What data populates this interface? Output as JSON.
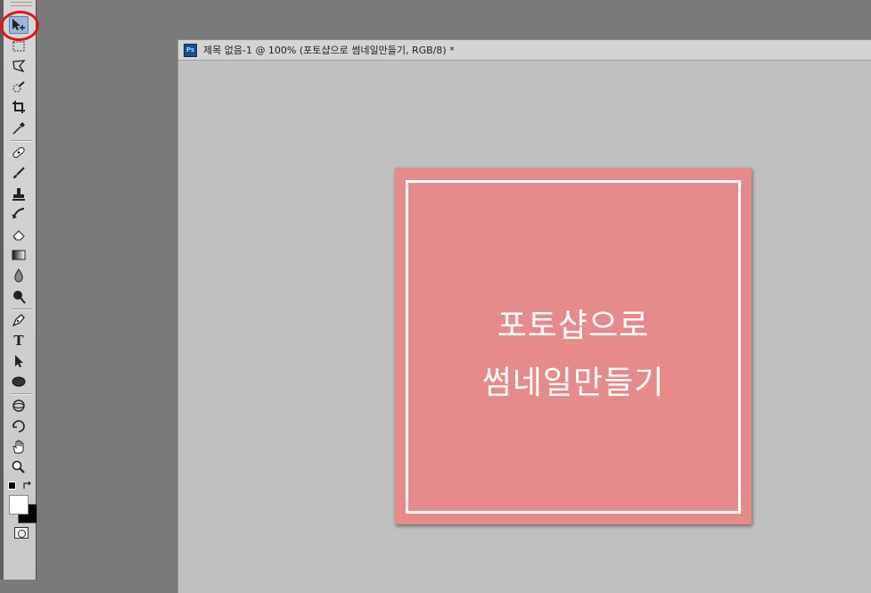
{
  "toolbar": {
    "tools": [
      {
        "name": "move-tool",
        "icon": "move-icon",
        "active": true
      },
      {
        "name": "marquee-tool",
        "icon": "rectangular-marquee-icon"
      },
      {
        "name": "lasso-tool",
        "icon": "polygonal-lasso-icon"
      },
      {
        "name": "quick-selection-tool",
        "icon": "quick-selection-icon"
      },
      {
        "name": "crop-tool",
        "icon": "crop-icon"
      },
      {
        "name": "eyedropper-tool",
        "icon": "eyedropper-icon"
      },
      {
        "name": "healing-brush-tool",
        "icon": "healing-brush-icon"
      },
      {
        "name": "brush-tool",
        "icon": "brush-icon"
      },
      {
        "name": "clone-stamp-tool",
        "icon": "clone-stamp-icon"
      },
      {
        "name": "history-brush-tool",
        "icon": "history-brush-icon"
      },
      {
        "name": "eraser-tool",
        "icon": "eraser-icon"
      },
      {
        "name": "gradient-tool",
        "icon": "gradient-icon"
      },
      {
        "name": "blur-tool",
        "icon": "blur-drop-icon"
      },
      {
        "name": "dodge-tool",
        "icon": "dodge-icon"
      },
      {
        "name": "pen-tool",
        "icon": "pen-icon"
      },
      {
        "name": "type-tool",
        "icon": "type-icon",
        "glyph": "T"
      },
      {
        "name": "path-selection-tool",
        "icon": "path-selection-icon"
      },
      {
        "name": "ellipse-tool",
        "icon": "ellipse-icon"
      },
      {
        "name": "3d-rotate-tool",
        "icon": "3d-rotate-icon"
      },
      {
        "name": "3d-orbit-tool",
        "icon": "3d-orbit-icon"
      },
      {
        "name": "hand-tool",
        "icon": "hand-icon"
      },
      {
        "name": "zoom-tool",
        "icon": "zoom-icon"
      }
    ],
    "foreground_color": "#ffffff",
    "background_color": "#000000"
  },
  "document": {
    "title": "제목 없음-1 @ 100% (포토샵으로 썸네일만들기, RGB/8) *",
    "app_icon_label": "Ps",
    "canvas_color": "#e58b8a",
    "frame_color": "#ffffff",
    "text_line1": "포토샵으로",
    "text_line2": "썸네일만들기"
  },
  "annotation": {
    "color": "#e0141b"
  }
}
